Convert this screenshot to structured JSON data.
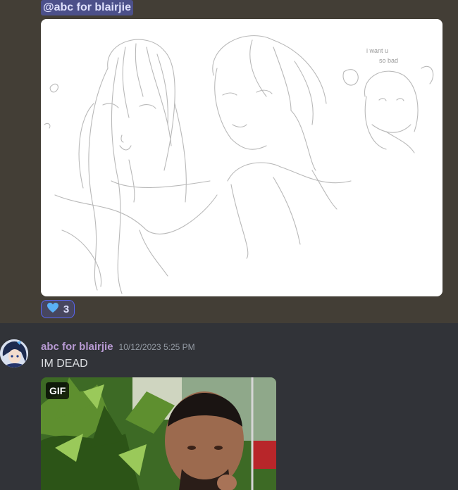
{
  "message1": {
    "mention": "@abc for blairjie",
    "attachment": {
      "sketch_note_line1": "i want u",
      "sketch_note_line2": "so bad"
    },
    "reaction": {
      "icon": "blue-heart-icon",
      "count": "3"
    }
  },
  "message2": {
    "username": "abc for blairjie",
    "timestamp": "10/12/2023 5:25 PM",
    "text": "IM DEAD",
    "gif_badge": "GIF"
  },
  "colors": {
    "background": "#313338",
    "highlight": "#433e36",
    "mention": "#5865f2",
    "username": "#b89ad3",
    "timestamp": "#949ba4"
  }
}
